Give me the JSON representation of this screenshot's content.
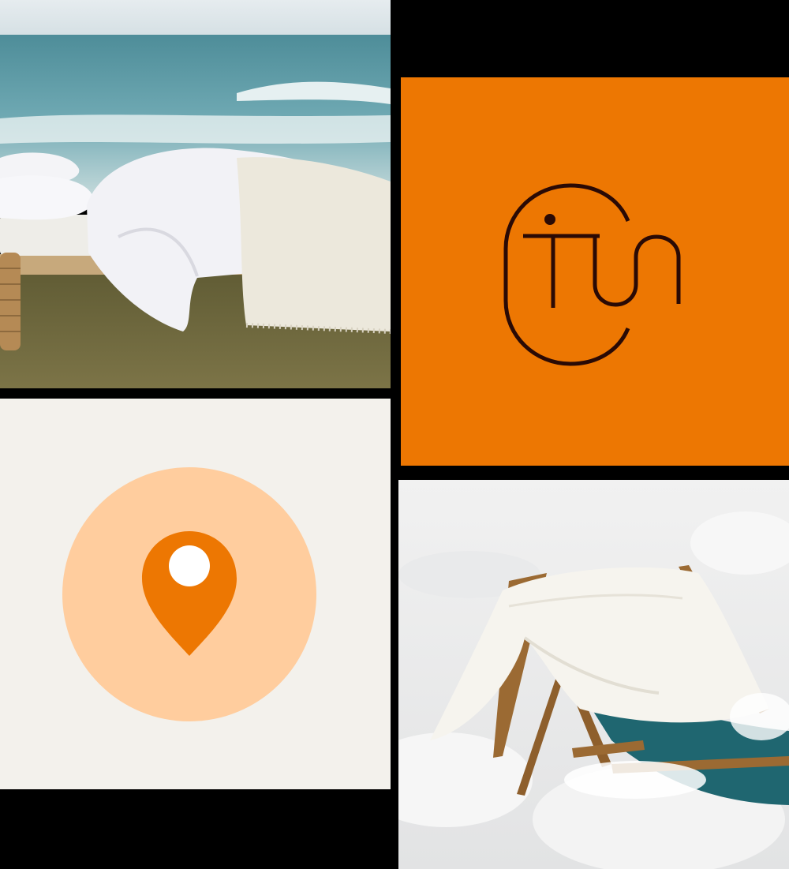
{
  "colors": {
    "page_background": "#000000",
    "brand_orange": "#ED7702",
    "logo_ink": "#2A0A05",
    "pin_panel_background": "#F3F1EC",
    "pin_circle": "#FFCD9E",
    "pin_marker": "#ED7702",
    "pin_dot": "#FFFFFF",
    "sea": "#6FA9B3",
    "sky": "#DCE6EA",
    "grass": "#6F6A3C",
    "linen": "#F2F2F4",
    "foam": "#ECECEC",
    "chair_canvas": "#1F6670",
    "chair_wood": "#9B6A33"
  },
  "tiles": [
    {
      "name": "beach-bed-photo",
      "depicts": "white-bed-on-grass-by-the-sea"
    },
    {
      "name": "brand-logo-panel",
      "depicts": "brand-monogram"
    },
    {
      "name": "location-pin-panel",
      "depicts": "map-pin-icon"
    },
    {
      "name": "beach-chair-photo",
      "depicts": "linen-draped-deck-chair-in-surf"
    }
  ]
}
